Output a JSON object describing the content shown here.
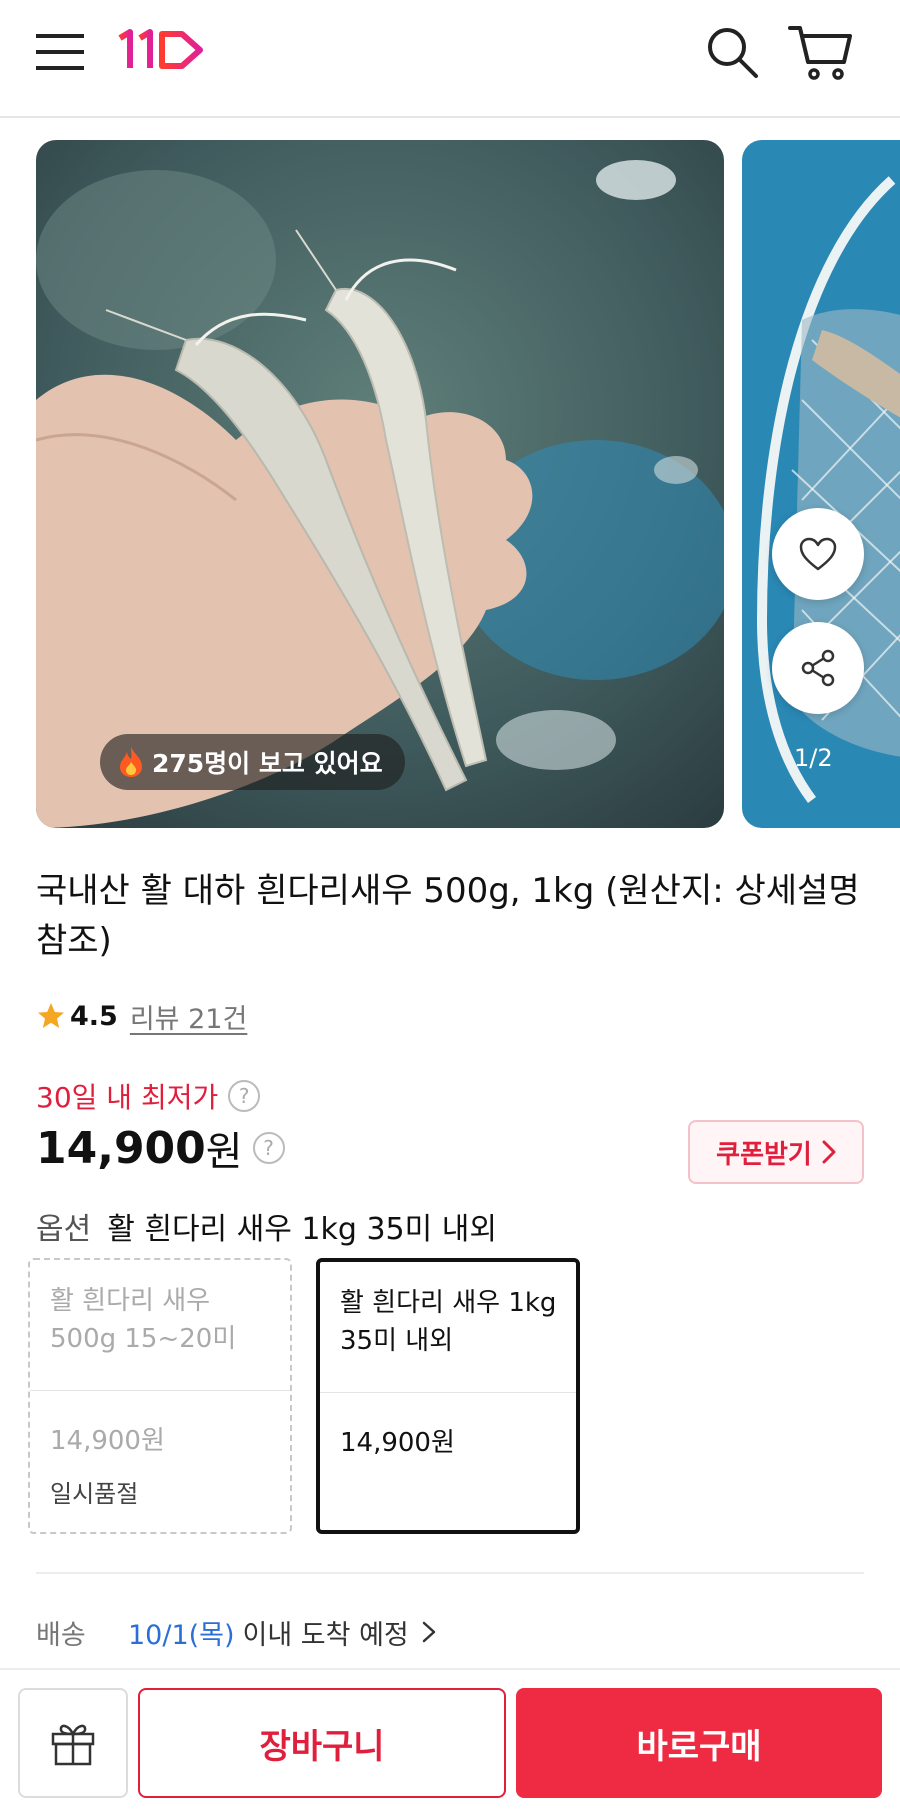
{
  "header": {
    "menu_icon": "hamburger-menu-icon",
    "logo_text": "11",
    "brand_color": "#e01f3d",
    "search_icon": "search-icon",
    "cart_icon": "cart-icon"
  },
  "gallery": {
    "viewer_badge": "275명이 보고 있어요",
    "page_indicator": "1/2",
    "like_icon": "heart-icon",
    "share_icon": "share-icon"
  },
  "product": {
    "title": "국내산 활 대하 흰다리새우 500g, 1kg (원산지: 상세설명 참조)",
    "rating": "4.5",
    "review_link": "리뷰 21건",
    "lowest_label": "30일 내 최저가",
    "price_value": "14,900",
    "price_unit": "원",
    "coupon_label": "쿠폰받기"
  },
  "options": {
    "label": "옵션",
    "selected": "활 흰다리 새우 1kg 35미 내외",
    "cards": [
      {
        "name": "활 흰다리 새우 500g 15~20미",
        "price": "14,900원",
        "status": "일시품절"
      },
      {
        "name": "활 흰다리 새우 1kg 35미 내외",
        "price": "14,900원",
        "status": ""
      }
    ]
  },
  "delivery": {
    "label": "배송",
    "date": "10/1(목)",
    "text": "이내 도착 예정"
  },
  "bottom_bar": {
    "gift_icon": "gift-icon",
    "cart_label": "장바구니",
    "buy_label": "바로구매",
    "accent_color": "#ef2b43"
  }
}
